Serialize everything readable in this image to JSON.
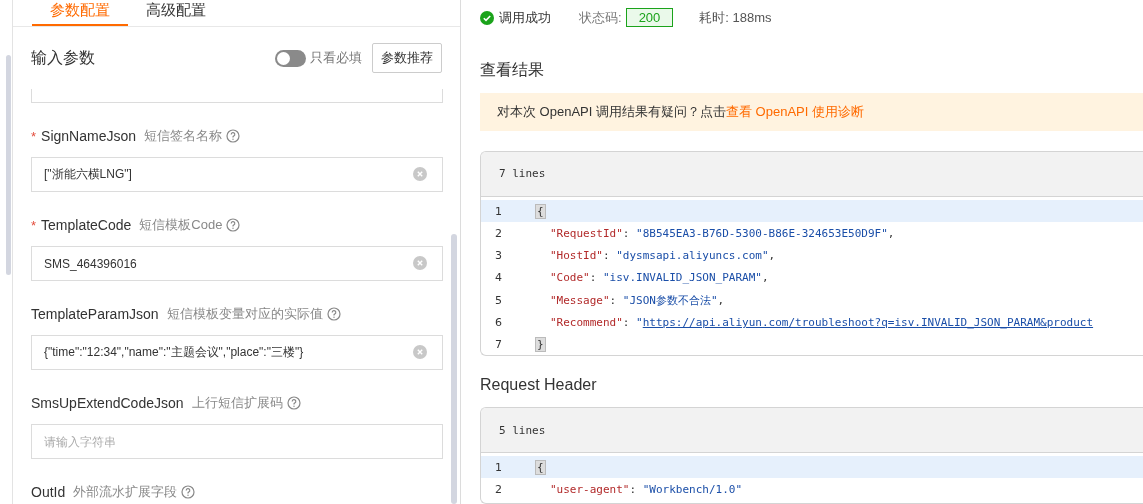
{
  "tabs": [
    {
      "label": "参数配置",
      "selected": true
    },
    {
      "label": "高级配置",
      "selected": false
    }
  ],
  "input_params": {
    "title": "输入参数",
    "required_only_toggle": {
      "label": "只看必填",
      "on": false
    },
    "recommend_button": "参数推荐",
    "fields": [
      {
        "required_mark": "*",
        "name": "SignNameJson",
        "description": "短信签名名称",
        "value": "[\"浙能六横LNG\"]"
      },
      {
        "required_mark": "*",
        "name": "TemplateCode",
        "description": "短信模板Code",
        "value": "SMS_464396016"
      },
      {
        "name": "TemplateParamJson",
        "description": "短信模板变量对应的实际值",
        "value": "{\"time\":\"12:34\",\"name\":\"主题会议\",\"place\":\"三楼\"}"
      },
      {
        "name": "SmsUpExtendCodeJson",
        "description": "上行短信扩展码",
        "placeholder": "请输入字符串"
      },
      {
        "name": "OutId",
        "description": "外部流水扩展字段"
      }
    ]
  },
  "result": {
    "status": "调用成功",
    "status_code_label": "状态码:",
    "status_code": "200",
    "time": "耗时: 188ms",
    "section_title": "查看结果",
    "notice_text": "对本次 OpenAPI 调用结果有疑问？点击",
    "notice_link": "查看 OpenAPI 使用诊断",
    "code_blocks": [
      {
        "line_count": "7 lines",
        "lines": [
          {
            "n": "1",
            "selected": true,
            "segments": [
              {
                "kind": "bracket",
                "t": "{"
              }
            ]
          },
          {
            "n": "2",
            "selected": false,
            "segments": [
              {
                "kind": "key",
                "t": "\"RequestId\""
              },
              {
                "kind": "punct",
                "t": ": "
              },
              {
                "kind": "string",
                "t": "\"8B545EA3-B76D-5300-B86E-324653E50D9F\""
              },
              {
                "kind": "punct",
                "t": ","
              }
            ]
          },
          {
            "n": "3",
            "selected": false,
            "segments": [
              {
                "kind": "key",
                "t": "\"HostId\""
              },
              {
                "kind": "punct",
                "t": ": "
              },
              {
                "kind": "string",
                "t": "\"dysmsapi.aliyuncs.com\""
              },
              {
                "kind": "punct",
                "t": ","
              }
            ]
          },
          {
            "n": "4",
            "selected": false,
            "segments": [
              {
                "kind": "key",
                "t": "\"Code\""
              },
              {
                "kind": "punct",
                "t": ": "
              },
              {
                "kind": "string",
                "t": "\"isv.INVALID_JSON_PARAM\""
              },
              {
                "kind": "punct",
                "t": ","
              }
            ]
          },
          {
            "n": "5",
            "selected": false,
            "segments": [
              {
                "kind": "key",
                "t": "\"Message\""
              },
              {
                "kind": "punct",
                "t": ": "
              },
              {
                "kind": "string",
                "t": "\"JSON参数不合法\""
              },
              {
                "kind": "punct",
                "t": ","
              }
            ]
          },
          {
            "n": "6",
            "selected": false,
            "segments": [
              {
                "kind": "key",
                "t": "\"Recommend\""
              },
              {
                "kind": "punct",
                "t": ": "
              },
              {
                "kind": "string",
                "t": "\""
              },
              {
                "kind": "link",
                "t": "https://api.aliyun.com/troubleshoot?q=isv.INVALID_JSON_PARAM&product"
              }
            ]
          },
          {
            "n": "7",
            "selected": false,
            "segments": [
              {
                "kind": "bracket",
                "t": "}"
              }
            ]
          }
        ]
      },
      {
        "title": "Request Header",
        "line_count": "5 lines",
        "lines": [
          {
            "n": "1",
            "selected": true,
            "segments": [
              {
                "kind": "bracket",
                "t": "{"
              }
            ]
          },
          {
            "n": "2",
            "selected": false,
            "segments": [
              {
                "kind": "key",
                "t": "\"user-agent\""
              },
              {
                "kind": "punct",
                "t": ": "
              },
              {
                "kind": "string",
                "t": "\"Workbench/1.0\""
              }
            ]
          }
        ]
      }
    ]
  }
}
